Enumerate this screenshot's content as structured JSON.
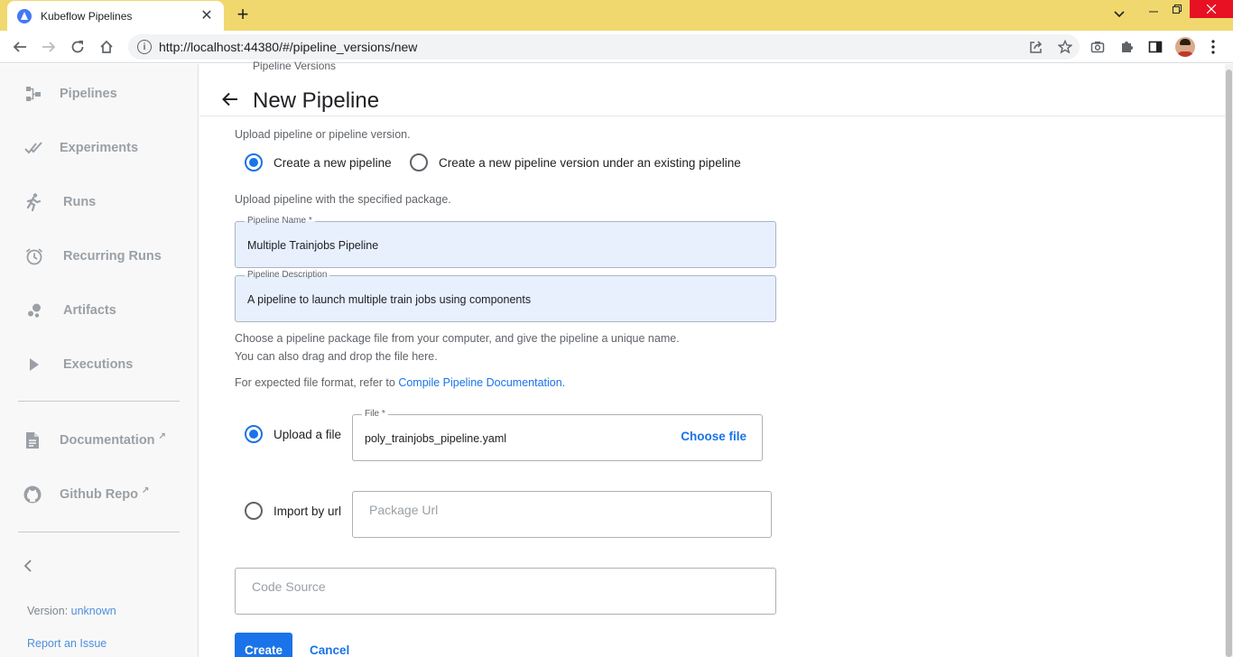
{
  "browser": {
    "tab_title": "Kubeflow Pipelines",
    "url": "http://localhost:44380/#/pipeline_versions/new",
    "accent": "#f0d86e"
  },
  "sidebar": {
    "items": [
      {
        "label": "Pipelines",
        "icon": "pipelines-icon"
      },
      {
        "label": "Experiments",
        "icon": "experiments-icon"
      },
      {
        "label": "Runs",
        "icon": "runs-icon"
      },
      {
        "label": "Recurring Runs",
        "icon": "alarm-clock-icon"
      },
      {
        "label": "Artifacts",
        "icon": "artifacts-icon"
      },
      {
        "label": "Executions",
        "icon": "play-icon"
      }
    ],
    "links": [
      {
        "label": "Documentation",
        "icon": "document-icon"
      },
      {
        "label": "Github Repo",
        "icon": "github-icon"
      }
    ],
    "version_label": "Version:",
    "version_value": "unknown",
    "report_issue": "Report an Issue"
  },
  "page": {
    "breadcrumb": "Pipeline Versions",
    "title": "New Pipeline",
    "upload_intro": "Upload pipeline or pipeline version.",
    "radio_new_pipeline": "Create a new pipeline",
    "radio_new_version": "Create a new pipeline version under an existing pipeline",
    "package_intro": "Upload pipeline with the specified package.",
    "name_legend": "Pipeline Name *",
    "name_value": "Multiple Trainjobs Pipeline",
    "desc_legend": "Pipeline Description",
    "desc_value": "A pipeline to launch multiple train jobs using components",
    "choose_line1": "Choose a pipeline package file from your computer, and give the pipeline a unique name.",
    "choose_line2": "You can also drag and drop the file here.",
    "format_prefix": "For expected file format, refer to ",
    "format_link": "Compile Pipeline Documentation",
    "format_suffix": ".",
    "upload_file_label": "Upload a file",
    "file_legend": "File *",
    "file_value": "poly_trainjobs_pipeline.yaml",
    "choose_file": "Choose file",
    "import_url_label": "Import by url",
    "package_url_placeholder": "Package Url",
    "code_source_placeholder": "Code Source",
    "create_button": "Create",
    "cancel_button": "Cancel"
  }
}
